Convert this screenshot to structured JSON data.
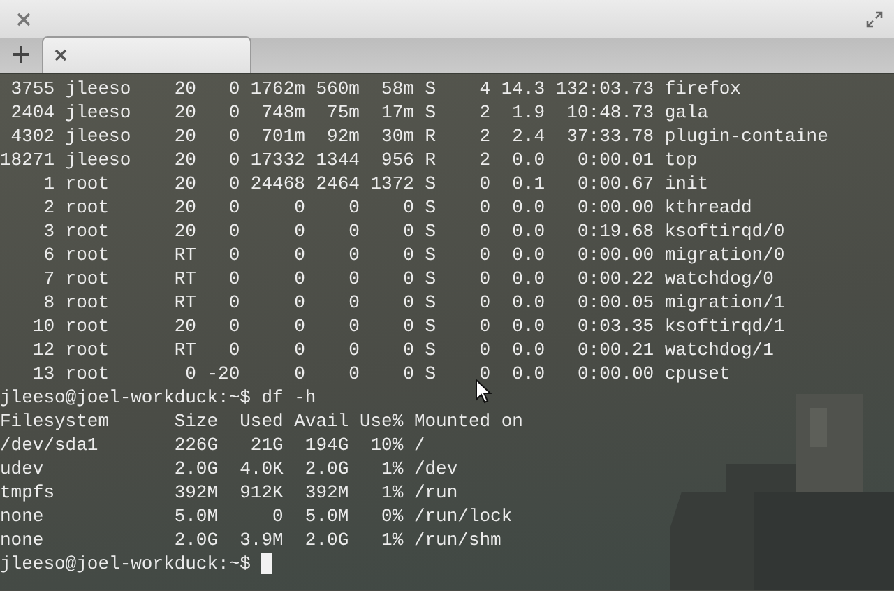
{
  "tabs": [
    {
      "selected": true
    }
  ],
  "terminal": {
    "lines": [
      " 3755 jleeso    20   0 1762m 560m  58m S    4 14.3 132:03.73 firefox",
      " 2404 jleeso    20   0  748m  75m  17m S    2  1.9  10:48.73 gala",
      " 4302 jleeso    20   0  701m  92m  30m R    2  2.4  37:33.78 plugin-containe",
      "18271 jleeso    20   0 17332 1344  956 R    2  0.0   0:00.01 top",
      "    1 root      20   0 24468 2464 1372 S    0  0.1   0:00.67 init",
      "    2 root      20   0     0    0    0 S    0  0.0   0:00.00 kthreadd",
      "    3 root      20   0     0    0    0 S    0  0.0   0:19.68 ksoftirqd/0",
      "    6 root      RT   0     0    0    0 S    0  0.0   0:00.00 migration/0",
      "    7 root      RT   0     0    0    0 S    0  0.0   0:00.22 watchdog/0",
      "    8 root      RT   0     0    0    0 S    0  0.0   0:00.05 migration/1",
      "   10 root      20   0     0    0    0 S    0  0.0   0:03.35 ksoftirqd/1",
      "   12 root      RT   0     0    0    0 S    0  0.0   0:00.21 watchdog/1",
      "   13 root       0 -20     0    0    0 S    0  0.0   0:00.00 cpuset",
      "jleeso@joel-workduck:~$ df -h",
      "Filesystem      Size  Used Avail Use% Mounted on",
      "/dev/sda1       226G   21G  194G  10% /",
      "udev            2.0G  4.0K  2.0G   1% /dev",
      "tmpfs           392M  912K  392M   1% /run",
      "none            5.0M     0  5.0M   0% /run/lock",
      "none            2.0G  3.9M  2.0G   1% /run/shm",
      "jleeso@joel-workduck:~$"
    ]
  }
}
